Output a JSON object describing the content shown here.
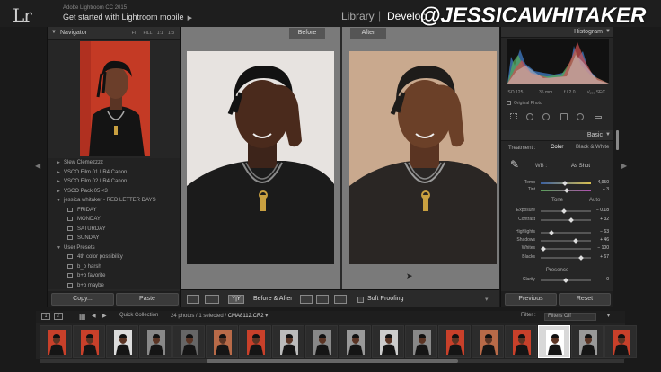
{
  "app": {
    "logo": "Lr",
    "subtitle": "Adobe Lightroom CC 2015",
    "identity": "Get started with Lightroom mobile",
    "modules": {
      "library": "Library",
      "separator": "|",
      "develop": "Develop"
    },
    "watermark": "@JESSICAWHITAKER"
  },
  "left_panel": {
    "navigator": {
      "title": "Navigator",
      "options": [
        "FIT",
        "FILL",
        "1:1",
        "1:3"
      ]
    },
    "presets": [
      {
        "label": "Slew Clemezzzz",
        "type": "folder"
      },
      {
        "label": "VSCO Film 01 LR4 Canon",
        "type": "folder"
      },
      {
        "label": "VSCO Film 02 LR4 Canon",
        "type": "folder"
      },
      {
        "label": "VSCO Pack 05 <3",
        "type": "folder"
      },
      {
        "label": "jessica whitaker - RED LETTER DAYS",
        "type": "open-folder"
      },
      {
        "label": "FRIDAY",
        "type": "preset"
      },
      {
        "label": "MONDAY",
        "type": "preset"
      },
      {
        "label": "SATURDAY",
        "type": "preset"
      },
      {
        "label": "SUNDAY",
        "type": "preset"
      },
      {
        "label": "User Presets",
        "type": "open-folder"
      },
      {
        "label": "4th color possibility",
        "type": "preset"
      },
      {
        "label": "b_b harsh",
        "type": "preset"
      },
      {
        "label": "b+b favorite",
        "type": "preset"
      },
      {
        "label": "b+b maybe",
        "type": "preset"
      },
      {
        "label": "favorite fix",
        "type": "preset"
      }
    ],
    "buttons": {
      "copy": "Copy...",
      "paste": "Paste"
    }
  },
  "center": {
    "before_label": "Before",
    "after_label": "After",
    "toolbar": {
      "yy": "Y|Y",
      "before_after": "Before & After :",
      "soft_proofing": "Soft Proofing"
    }
  },
  "right_panel": {
    "histogram": {
      "title": "Histogram",
      "meta": {
        "iso": "ISO 125",
        "focal": "35 mm",
        "aperture": "f / 2.0",
        "shutter": "¹⁄₁₃₀ SEC"
      },
      "original": "Original Photo"
    },
    "basic": {
      "title": "Basic",
      "treatment_label": "Treatment :",
      "treatment_color": "Color",
      "treatment_bw": "Black & White",
      "wb_label": "WB :",
      "wb_value": "As Shot",
      "tone_label": "Tone",
      "auto_label": "Auto",
      "presence_label": "Presence",
      "sliders": [
        {
          "label": "Temp",
          "value": "4,950",
          "pos": 0.48
        },
        {
          "label": "Tint",
          "value": "+ 3",
          "pos": 0.52
        },
        {
          "label": "Exposure",
          "value": "− 0.18",
          "pos": 0.47
        },
        {
          "label": "Contrast",
          "value": "+ 32",
          "pos": 0.62
        },
        {
          "label": "Highlights",
          "value": "− 63",
          "pos": 0.2
        },
        {
          "label": "Shadows",
          "value": "+ 46",
          "pos": 0.72
        },
        {
          "label": "Whites",
          "value": "− 100",
          "pos": 0.02
        },
        {
          "label": "Blacks",
          "value": "+ 67",
          "pos": 0.83
        },
        {
          "label": "Clarity",
          "value": "0",
          "pos": 0.5
        }
      ]
    },
    "buttons": {
      "previous": "Previous",
      "reset": "Reset"
    }
  },
  "filmstrip_bar": {
    "page1": "1",
    "page2": "2",
    "source": "Quick Collection",
    "info_prefix": "24 photos / 1 selected /",
    "filename": "CMA8112.CR2",
    "filter_label": "Filter :",
    "filter_value": "Filters Off"
  },
  "filmstrip": {
    "thumbnails": [
      {
        "bg": "#c8402a"
      },
      {
        "bg": "#c8402a"
      },
      {
        "bg": "#dcdcdc"
      },
      {
        "bg": "#888"
      },
      {
        "bg": "#666"
      },
      {
        "bg": "#b86a48"
      },
      {
        "bg": "#c8402a"
      },
      {
        "bg": "#bbb"
      },
      {
        "bg": "#888"
      },
      {
        "bg": "#999"
      },
      {
        "bg": "#ccc"
      },
      {
        "bg": "#888"
      },
      {
        "bg": "#c8402a"
      },
      {
        "bg": "#b86a48"
      },
      {
        "bg": "#c8402a"
      },
      {
        "bg": "#fff",
        "selected": true
      },
      {
        "bg": "#999"
      },
      {
        "bg": "#c8402a"
      }
    ]
  },
  "colors": {
    "accent": "#ffffff",
    "panel": "#262626",
    "background": "#1a1a1a",
    "red_backdrop": "#c43a25"
  }
}
